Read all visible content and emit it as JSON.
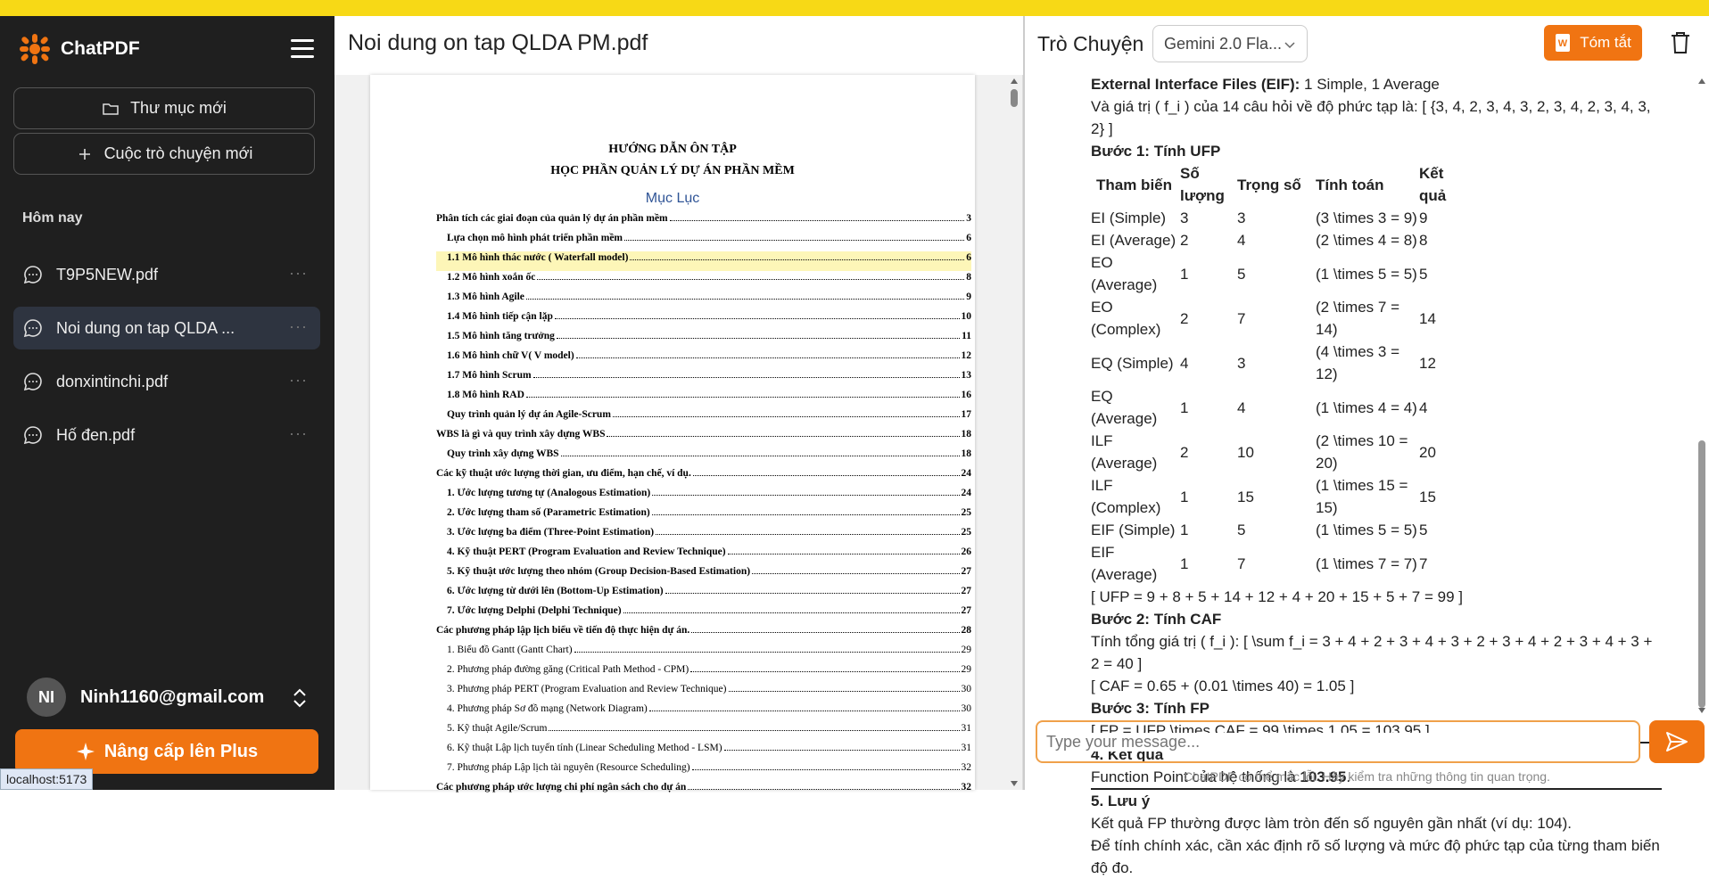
{
  "brand": {
    "name": "ChatPDF",
    "logo_color": "#f07412"
  },
  "sidebar": {
    "new_folder_label": "Thư mục mới",
    "new_chat_label": "Cuộc trò chuyện mới",
    "section_today": "Hôm nay",
    "conversations": [
      {
        "label": "T9P5NEW.pdf",
        "active": false
      },
      {
        "label": "Noi dung on tap QLDA ...",
        "active": true
      },
      {
        "label": "donxintinchi.pdf",
        "active": false
      },
      {
        "label": "Hố đen.pdf",
        "active": false
      }
    ],
    "more_label": "···",
    "user": {
      "initials": "NI",
      "email": "Ninh1160@gmail.com"
    },
    "upgrade_label": "Nâng cấp lên Plus",
    "status_url": "localhost:5173"
  },
  "pdf": {
    "title": "Noi dung on tap QLDA PM.pdf",
    "heading1": "HƯỚNG DẪN ÔN TẬP",
    "heading2": "HỌC PHẦN  QUẢN LÝ DỰ ÁN PHẦN MỀM",
    "toc_label": "Mục Lục",
    "toc": [
      {
        "text": "Phân tích các giai đoạn của quản lý dự án phần mềm",
        "page": "3",
        "indent": 0,
        "bold": true
      },
      {
        "text": "Lựa chọn mô hình phát triển phần mềm",
        "page": "6",
        "indent": 1,
        "bold": true
      },
      {
        "text": "1.1 Mô hình thác nước ( Waterfall model)",
        "page": "6",
        "indent": 1,
        "bold": true,
        "highlight": true
      },
      {
        "text": "1.2 Mô hình xoắn ốc",
        "page": "8",
        "indent": 1,
        "bold": true
      },
      {
        "text": "1.3 Mô hình Agile",
        "page": "9",
        "indent": 1,
        "bold": true
      },
      {
        "text": "1.4 Mô hình tiếp cận lặp",
        "page": "10",
        "indent": 1,
        "bold": true
      },
      {
        "text": "1.5 Mô hình tăng trưởng",
        "page": "11",
        "indent": 1,
        "bold": true
      },
      {
        "text": "1.6 Mô hình chữ V( V model)",
        "page": "12",
        "indent": 1,
        "bold": true
      },
      {
        "text": "1.7 Mô hình Scrum",
        "page": "13",
        "indent": 1,
        "bold": true
      },
      {
        "text": "1.8 Mô hình RAD",
        "page": "16",
        "indent": 1,
        "bold": true
      },
      {
        "text": "Quy trình quản lý dự án Agile-Scrum",
        "page": "17",
        "indent": 1,
        "bold": true
      },
      {
        "text": "WBS là gì và quy trình xây dựng WBS",
        "page": "18",
        "indent": 0,
        "bold": true
      },
      {
        "text": "Quy trình xây dựng WBS",
        "page": "18",
        "indent": 1,
        "bold": true
      },
      {
        "text": "Các kỹ thuật ước lượng thời gian, ưu điểm, hạn chế, ví dụ.",
        "page": "24",
        "indent": 0,
        "bold": true
      },
      {
        "text": "1. Ước lượng tương tự (Analogous Estimation)",
        "page": "24",
        "indent": 1,
        "bold": true
      },
      {
        "text": "2. Ước lượng tham số (Parametric Estimation)",
        "page": "25",
        "indent": 1,
        "bold": true
      },
      {
        "text": "3. Ước lượng ba điểm (Three-Point Estimation)",
        "page": "25",
        "indent": 1,
        "bold": true
      },
      {
        "text": "4. Kỹ thuật PERT (Program Evaluation and Review Technique)",
        "page": "26",
        "indent": 1,
        "bold": true
      },
      {
        "text": "5. Kỹ thuật ước lượng theo nhóm (Group Decision-Based Estimation)",
        "page": "27",
        "indent": 1,
        "bold": true
      },
      {
        "text": "6. Ước lượng từ dưới lên (Bottom-Up Estimation)",
        "page": "27",
        "indent": 1,
        "bold": true
      },
      {
        "text": "7. Ước lượng Delphi (Delphi Technique)",
        "page": "27",
        "indent": 1,
        "bold": true
      },
      {
        "text": "Các phương pháp lập lịch biểu về tiến độ thực hiện dự án.",
        "page": "28",
        "indent": 0,
        "bold": true
      },
      {
        "text": "1. Biểu đồ Gantt (Gantt Chart)",
        "page": "29",
        "indent": 1,
        "bold": false
      },
      {
        "text": "2. Phương pháp đường găng (Critical Path Method - CPM)",
        "page": "29",
        "indent": 1,
        "bold": false
      },
      {
        "text": "3. Phương pháp PERT (Program Evaluation and Review Technique)",
        "page": "30",
        "indent": 1,
        "bold": false
      },
      {
        "text": "4. Phương pháp Sơ đồ mạng (Network Diagram)",
        "page": "30",
        "indent": 1,
        "bold": false
      },
      {
        "text": "5. Kỹ thuật Agile/Scrum",
        "page": "31",
        "indent": 1,
        "bold": false
      },
      {
        "text": "6. Kỹ thuật Lập lịch tuyến tính (Linear Scheduling Method - LSM)",
        "page": "31",
        "indent": 1,
        "bold": false
      },
      {
        "text": "7. Phương pháp Lập lịch tài nguyên (Resource Scheduling)",
        "page": "32",
        "indent": 1,
        "bold": false
      },
      {
        "text": "Các phương pháp ước lượng chi phí ngân sách cho dự án",
        "page": "32",
        "indent": 0,
        "bold": true
      }
    ]
  },
  "chat": {
    "title": "Trò Chuyện",
    "model": "Gemini 2.0 Fla...",
    "summary_label": "Tóm tắt",
    "eif_label": "External Interface Files (EIF):",
    "eif_value": " 1 Simple, 1 Average",
    "fi_line": "Và giá trị ( f_i ) của 14 câu hỏi về độ phức tạp là: [ {3, 4, 2, 3, 4, 3, 2, 3, 4, 2, 3, 4, 3, 2} ]",
    "step1": "Bước 1: Tính UFP",
    "table_headers": [
      "Tham biến",
      "Số lượng",
      "Trọng số",
      "Tính toán",
      "Kết quả"
    ],
    "table_rows": [
      [
        "EI (Simple)",
        "3",
        "3",
        "(3 \\times 3 = 9)",
        "9"
      ],
      [
        "EI (Average)",
        "2",
        "4",
        "(2 \\times 4 = 8)",
        "8"
      ],
      [
        "EO (Average)",
        "1",
        "5",
        "(1 \\times 5 = 5)",
        "5"
      ],
      [
        "EO (Complex)",
        "2",
        "7",
        "(2 \\times 7 = 14)",
        "14"
      ],
      [
        "EQ (Simple)",
        "4",
        "3",
        "(4 \\times 3 = 12)",
        "12"
      ],
      [
        "EQ (Average)",
        "1",
        "4",
        "(1 \\times 4 = 4)",
        "4"
      ],
      [
        "ILF (Average)",
        "2",
        "10",
        "(2 \\times 10 = 20)",
        "20"
      ],
      [
        "ILF (Complex)",
        "1",
        "15",
        "(1 \\times 15 = 15)",
        "15"
      ],
      [
        "EIF (Simple)",
        "1",
        "5",
        "(1 \\times 5 = 5)",
        "5"
      ],
      [
        "EIF (Average)",
        "1",
        "7",
        "(1 \\times 7 = 7)",
        "7"
      ]
    ],
    "ufp_line": "[ UFP = 9 + 8 + 5 + 14 + 12 + 4 + 20 + 15 + 5 + 7 = 99 ]",
    "step2": "Bước 2: Tính CAF",
    "sum_line": "Tính tổng giá trị ( f_i ): [ \\sum f_i = 3 + 4 + 2 + 3 + 4 + 3 + 2 + 3 + 4 + 2 + 3 + 4 + 3 + 2 = 40 ]",
    "caf_line": "[ CAF = 0.65 + (0.01 \\times 40) = 1.05 ]",
    "step3": "Bước 3: Tính FP",
    "fp_line": "[ FP = UFP \\times CAF = 99 \\times 1.05 = 103.95 ]",
    "result_heading": "4. Kết quả",
    "result_text": "Function Point của hệ thống là ",
    "result_value": "103.95",
    "result_end": ".",
    "note_heading": "5. Lưu ý",
    "note1": "Kết quả FP thường được làm tròn đến số nguyên gần nhất (ví dụ: 104).",
    "note2": "Để tính chính xác, cần xác định rõ số lượng và mức độ phức tạp của từng tham biến độ đo.",
    "input_placeholder": "Type your message...",
    "footer": "ChatPDF có thể mắc lỗi. Hãy kiểm tra những thông tin quan trọng."
  },
  "colors": {
    "accent": "#f07412",
    "sidebar_bg": "#1f1f1f",
    "topstrip": "#f7d916"
  }
}
